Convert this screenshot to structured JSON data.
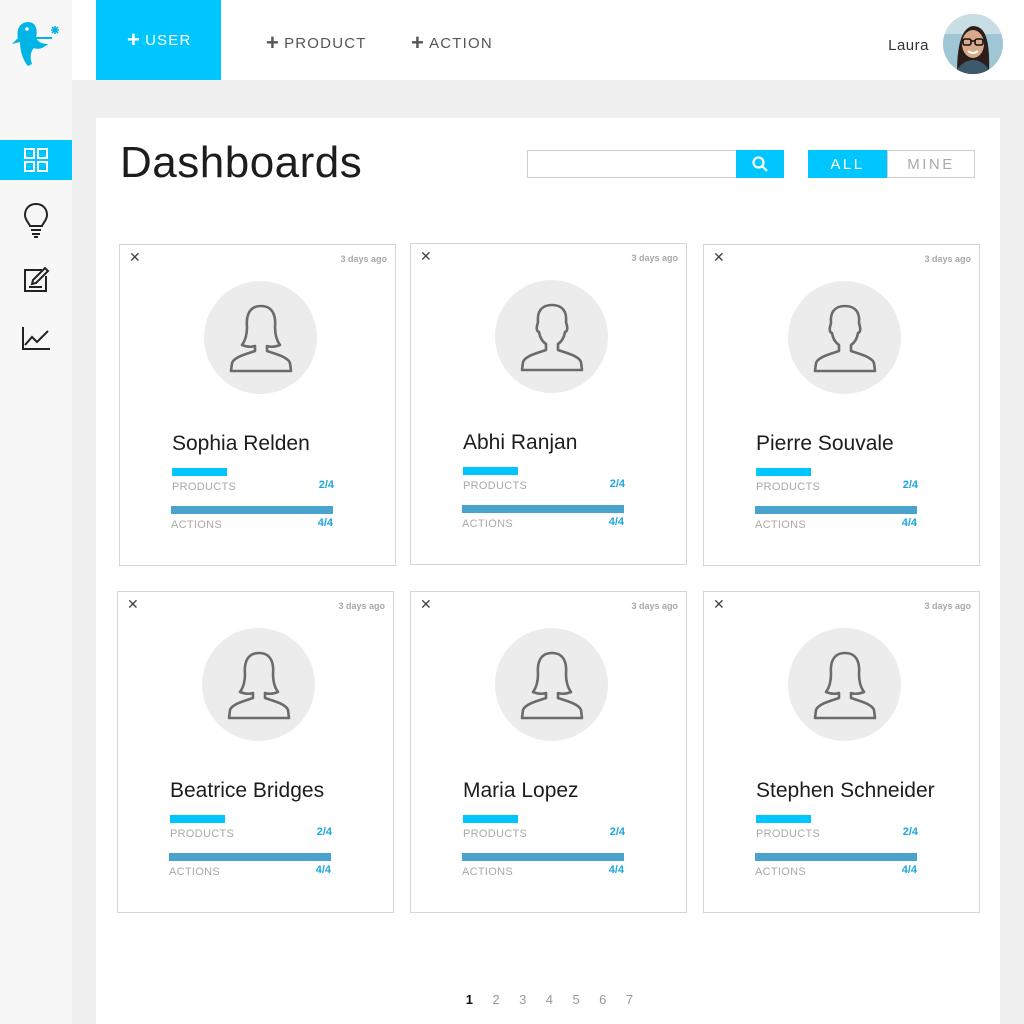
{
  "nav": {
    "top_tabs": [
      {
        "label": "USER",
        "active": true
      },
      {
        "label": "PRODUCT",
        "active": false
      },
      {
        "label": "ACTION",
        "active": false
      }
    ],
    "user_name": "Laura",
    "sidebar_items": [
      {
        "icon": "grid-icon",
        "active": true
      },
      {
        "icon": "lightbulb-icon",
        "active": false
      },
      {
        "icon": "edit-icon",
        "active": false
      },
      {
        "icon": "chart-icon",
        "active": false
      }
    ]
  },
  "main": {
    "title": "Dashboards",
    "search": {
      "placeholder": "",
      "value": ""
    },
    "filters": {
      "all": "ALL",
      "mine": "MINE",
      "selected": "ALL"
    },
    "cards": [
      {
        "name": "Sophia Relden",
        "time": "3 days ago",
        "products_label": "PRODUCTS",
        "products_value": "2/4",
        "products_fraction": 0.5,
        "actions_label": "ACTIONS",
        "actions_value": "4/4",
        "actions_fraction": 1.0,
        "avatar": "female"
      },
      {
        "name": "Abhi Ranjan",
        "time": "3 days ago",
        "products_label": "PRODUCTS",
        "products_value": "2/4",
        "products_fraction": 0.5,
        "actions_label": "ACTIONS",
        "actions_value": "4/4",
        "actions_fraction": 1.0,
        "avatar": "male"
      },
      {
        "name": "Pierre Souvale",
        "time": "3 days ago",
        "products_label": "PRODUCTS",
        "products_value": "2/4",
        "products_fraction": 0.5,
        "actions_label": "ACTIONS",
        "actions_value": "4/4",
        "actions_fraction": 1.0,
        "avatar": "male"
      },
      {
        "name": "Beatrice Bridges",
        "time": "3 days ago",
        "products_label": "PRODUCTS",
        "products_value": "2/4",
        "products_fraction": 0.5,
        "actions_label": "ACTIONS",
        "actions_value": "4/4",
        "actions_fraction": 1.0,
        "avatar": "female"
      },
      {
        "name": "Maria Lopez",
        "time": "3 days ago",
        "products_label": "PRODUCTS",
        "products_value": "2/4",
        "products_fraction": 0.5,
        "actions_label": "ACTIONS",
        "actions_value": "4/4",
        "actions_fraction": 1.0,
        "avatar": "female"
      },
      {
        "name": "Stephen Schneider",
        "time": "3 days ago",
        "products_label": "PRODUCTS",
        "products_value": "2/4",
        "products_fraction": 0.5,
        "actions_label": "ACTIONS",
        "actions_value": "4/4",
        "actions_fraction": 1.0,
        "avatar": "female"
      }
    ],
    "pagination": {
      "pages": [
        "1",
        "2",
        "3",
        "4",
        "5",
        "6",
        "7"
      ],
      "current": "1"
    }
  },
  "colors": {
    "accent": "#00c6ff",
    "bar_actions": "#4aa3cc",
    "value_text": "#1ba7dd"
  }
}
